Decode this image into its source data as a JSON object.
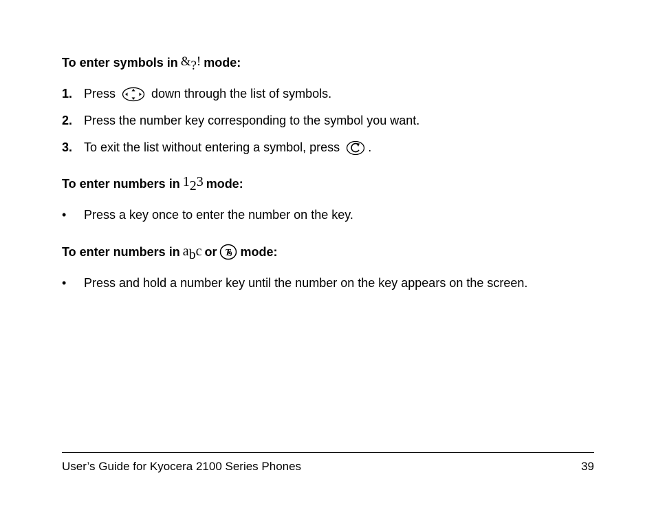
{
  "section1": {
    "heading_pre": "To enter symbols in ",
    "heading_post": " mode:",
    "steps": [
      {
        "num": "1.",
        "pre": "Press ",
        "post": " down through the list of symbols."
      },
      {
        "num": "2.",
        "text": "Press the number key corresponding to the symbol you want."
      },
      {
        "num": "3.",
        "pre": "To exit the list without entering a symbol, press ",
        "post": "."
      }
    ]
  },
  "section2": {
    "heading_pre": "To enter numbers in ",
    "heading_post": " mode:",
    "bullet1": "Press a key once to enter the number on the key."
  },
  "section3": {
    "heading_pre": "To enter numbers in ",
    "heading_mid": " or ",
    "heading_post": " mode:",
    "bullet1": "Press and hold a number key until the number on the key appears on the screen."
  },
  "footer": {
    "title": "User’s Guide for Kyocera 2100 Series Phones",
    "page": "39"
  },
  "bullet_char": "•"
}
